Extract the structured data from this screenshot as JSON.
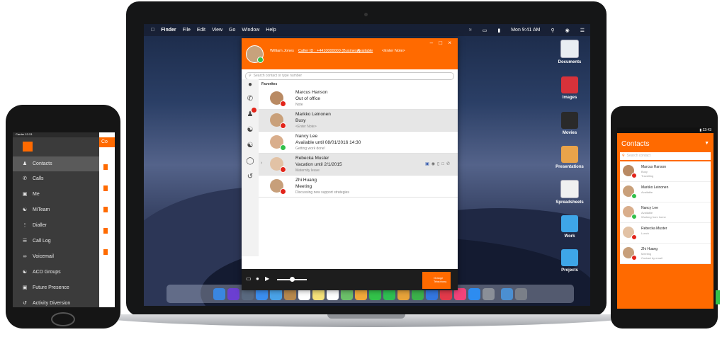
{
  "colors": {
    "brand_orange": "#ff6a00",
    "available": "#31c04a",
    "busy": "#e2241a"
  },
  "laptop": {
    "menubar": {
      "apple_icon": "apple-icon",
      "items": [
        "Finder",
        "File",
        "Edit",
        "View",
        "Go",
        "Window",
        "Help"
      ],
      "clock": "Mon 9:41 AM"
    },
    "desktop_icons": [
      "Documents",
      "Images",
      "Movies",
      "Presentations",
      "Spreadsheets",
      "Work",
      "Projects"
    ]
  },
  "app": {
    "window_controls": "– □ ×",
    "user_name": "William Jones",
    "caller_id": "Caller ID : +4410000000 (Business)",
    "status": "Available",
    "note": "<Enter Note>",
    "search_placeholder": "Search contact or type number",
    "favorites_label": "Favorites",
    "contacts": [
      {
        "name": "Marcus Hanson",
        "status": "Out of office",
        "note": "Note",
        "presence": "busy"
      },
      {
        "name": "Markko Leinonen",
        "status": "Busy",
        "note": "<Enter Note>",
        "presence": "busy"
      },
      {
        "name": "Nancy Lee",
        "status": "Available until 08/01/2016 14:30",
        "note": "Getting work done!",
        "presence": "available"
      },
      {
        "name": "Rebecka Muster",
        "status": "Vacation until 2/1/2015",
        "note": "Maternity leave",
        "presence": "busy"
      },
      {
        "name": "Zhi Huang",
        "status": "Meeting",
        "note": "Discussing new support strategies",
        "presence": "busy"
      }
    ],
    "footer_logo": "Orange Telephony",
    "volume": 0.55
  },
  "left_phone": {
    "status_bar": "Carrier  12:13",
    "brand": "orange",
    "menu": [
      "Contacts",
      "Calls",
      "Me",
      "MiTeam",
      "Dialler",
      "Call Log",
      "Voicemail",
      "ACD Groups",
      "Future Presence",
      "Activity Diversion"
    ],
    "peek_title": "Co"
  },
  "right_phone": {
    "status_time": "12:43",
    "title": "Contacts",
    "search_placeholder": "Search contact",
    "contacts": [
      {
        "name": "Marcus Hanson",
        "line2": "Busy",
        "line3": "Travelling",
        "presence": "busy"
      },
      {
        "name": "Markko Leinonen",
        "line2": "Available",
        "line3": "",
        "presence": "available"
      },
      {
        "name": "Nancy Lee",
        "line2": "Available",
        "line3": "Working from home",
        "presence": "available"
      },
      {
        "name": "Rebecka Muster",
        "line2": "Lunch",
        "line3": "",
        "presence": "busy"
      },
      {
        "name": "Zhi Huang",
        "line2": "Meeting",
        "line3": "Contact by email",
        "presence": "busy"
      }
    ]
  }
}
